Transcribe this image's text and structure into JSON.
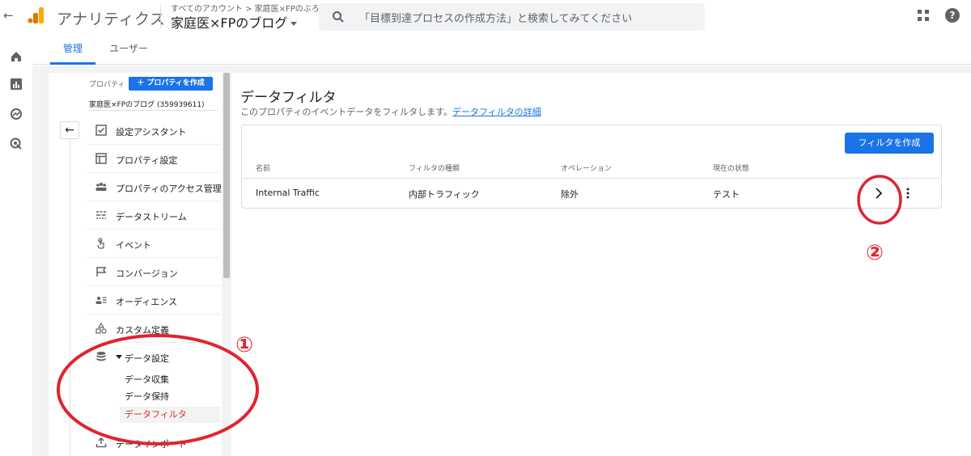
{
  "topbar": {
    "brand": "アナリティクス",
    "breadcrumb": "すべてのアカウント > 家庭医×FPのぶろぐ",
    "property_name": "家庭医×FPのブログ",
    "search_placeholder": "「目標到達プロセスの作成方法」と検索してみてください"
  },
  "tabs": [
    {
      "label": "管理",
      "active": true
    },
    {
      "label": "ユーザー",
      "active": false
    }
  ],
  "property_panel": {
    "label": "プロパティ",
    "create_button": "＋ プロパティを作成",
    "property_id": "家庭医×FPのブログ (359939611)"
  },
  "nav": {
    "items": [
      {
        "label": "設定アシスタント",
        "icon": "checkbox-icon"
      },
      {
        "label": "プロパティ設定",
        "icon": "window-icon"
      },
      {
        "label": "プロパティのアクセス管理",
        "icon": "people-icon"
      },
      {
        "label": "データストリーム",
        "icon": "streams-icon"
      },
      {
        "label": "イベント",
        "icon": "touch-icon"
      },
      {
        "label": "コンバージョン",
        "icon": "flag-icon"
      },
      {
        "label": "オーディエンス",
        "icon": "audience-icon"
      },
      {
        "label": "カスタム定義",
        "icon": "shapes-icon"
      },
      {
        "label": "データ設定",
        "icon": "database-icon"
      }
    ],
    "sub_items": [
      {
        "label": "データ収集",
        "active": false
      },
      {
        "label": "データ保持",
        "active": false
      },
      {
        "label": "データフィルタ",
        "active": true
      }
    ],
    "partial_item": "データインポート"
  },
  "main": {
    "title": "データフィルタ",
    "description": "このプロパティのイベントデータをフィルタします。",
    "description_link": "データフィルタの詳細",
    "create_button": "フィルタを作成",
    "columns": [
      "名前",
      "フィルタの種類",
      "オペレーション",
      "現在の状態"
    ],
    "rows": [
      {
        "name": "Internal Traffic",
        "type": "内部トラフィック",
        "operation": "除外",
        "status": "テスト"
      }
    ]
  },
  "annotations": {
    "marker_1": "①",
    "marker_2": "②",
    "color": "#e0242f"
  },
  "colors": {
    "accent": "#1a73e8",
    "active_nav": "#d93025",
    "canvas": "#f1f3f4"
  }
}
